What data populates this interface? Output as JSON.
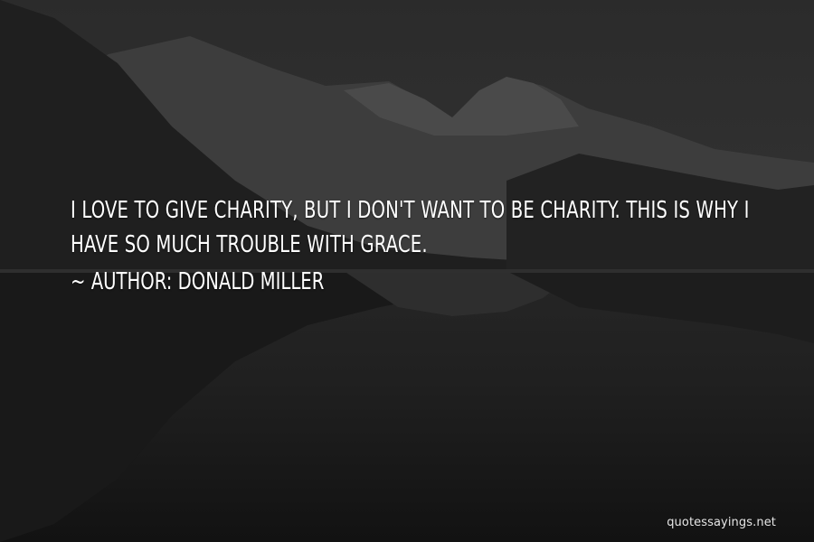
{
  "quote": {
    "text": "I LOVE TO GIVE CHARITY, BUT I DON'T WANT TO BE CHARITY. THIS IS WHY I HAVE SO MUCH TROUBLE WITH GRACE.",
    "author_prefix": "~ AUTHOR: ",
    "author": "DONALD MILLER"
  },
  "watermark": "quotessayings.net"
}
